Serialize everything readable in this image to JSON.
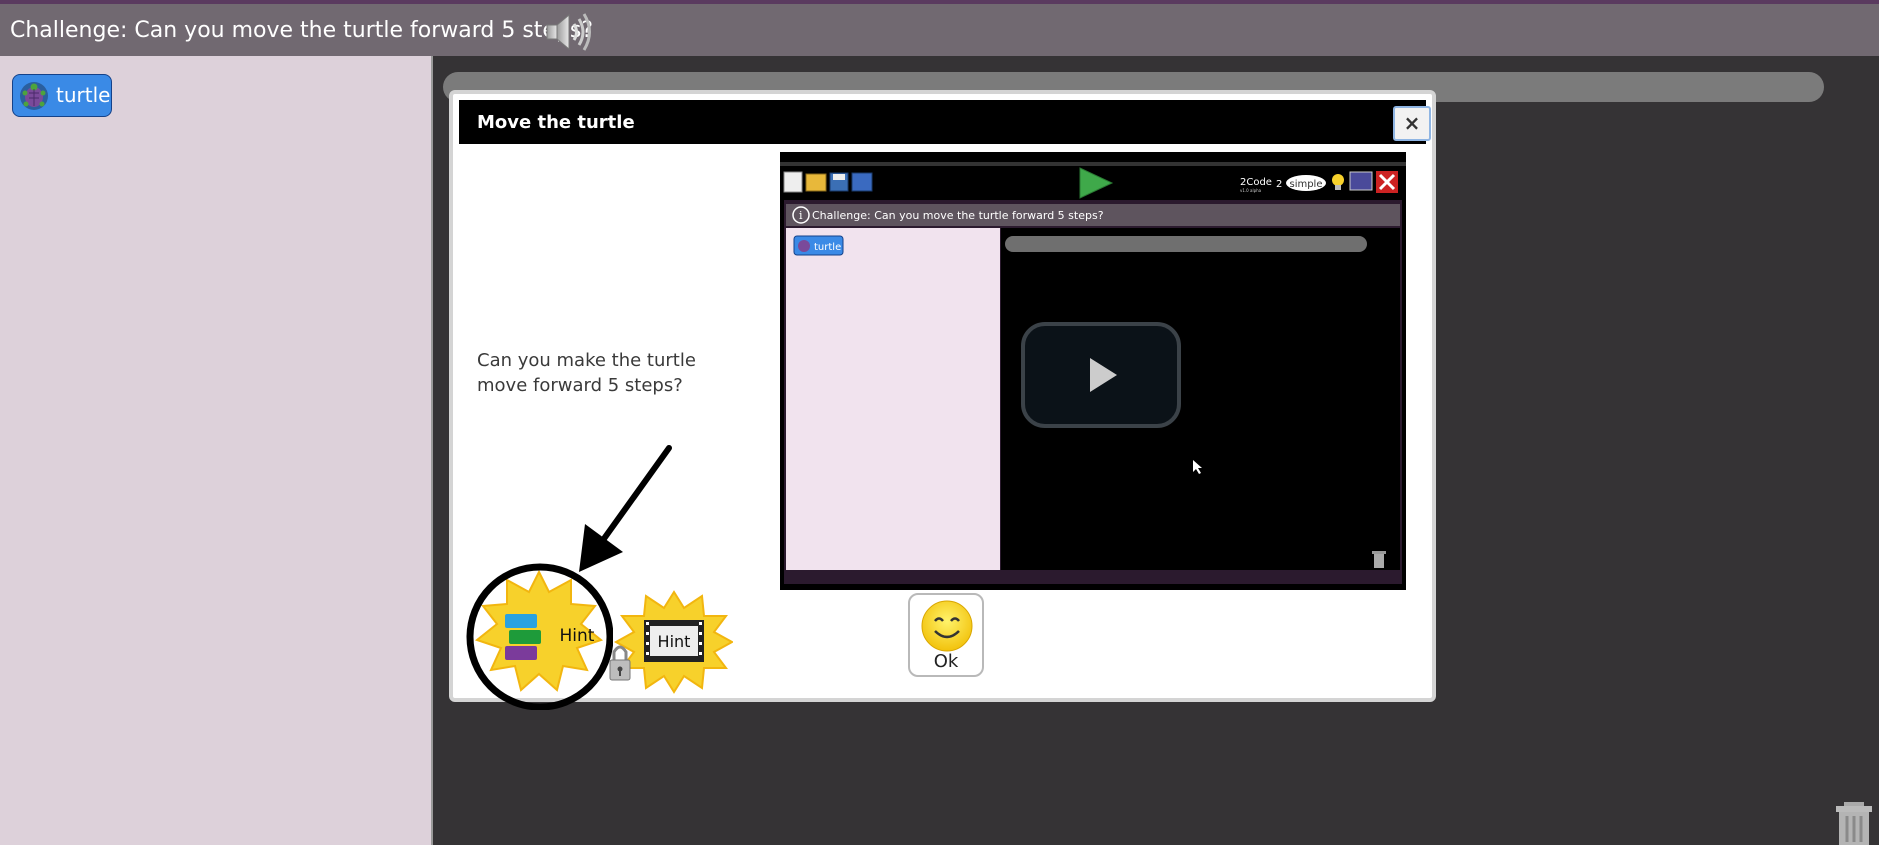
{
  "topbar": {
    "challenge": "Challenge: Can you move the turtle forward 5 steps?",
    "speaker_icon": "speaker-icon"
  },
  "sprite_panel": {
    "sprite_label": "turtle",
    "sprite_icon": "turtle-icon"
  },
  "modal": {
    "title": "Move the turtle",
    "close_label": "×",
    "question": "Can you make the turtle move forward 5 steps?",
    "hint_block_label": "Hint",
    "hint_video_label": "Hint",
    "ok_label": "Ok"
  },
  "video": {
    "app_name": "2Code",
    "app_version": "v1.0 alpha",
    "brand": "simple",
    "challenge": "Challenge: Can you move the turtle forward 5 steps?",
    "sprite_label": "turtle"
  },
  "colors": {
    "topbar": "#716971",
    "sprite_panel": "#ddd1da",
    "sprite_chip": "#3a8ae6",
    "hint_star": "#f7d12b",
    "modal_header": "#000000"
  }
}
